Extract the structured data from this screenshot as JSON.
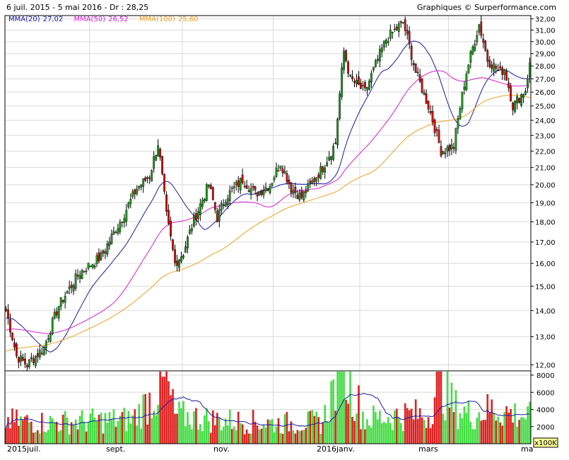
{
  "header": {
    "info": "6 juil. 2015 - 5 mai 2016 - Dr : 28,25",
    "brand": "Graphiques © Surperformance.com"
  },
  "legend": [
    {
      "label": "MMA(20)",
      "value": "27,02",
      "color": "#1a1aa8"
    },
    {
      "label": "MMA(50)",
      "value": "26,52",
      "color": "#d61fd6"
    },
    {
      "label": "MMA(100)",
      "value": "25,60",
      "color": "#f0a020"
    }
  ],
  "colors": {
    "up": "#1f9a1f",
    "down": "#d01010",
    "vol_up": "#44dd44",
    "vol_down": "#dd2020",
    "vol_avg": "#1a1aa8",
    "grid": "#d9d9d9"
  },
  "x_labels": [
    "2015juil.",
    "sept.",
    "nov.",
    "2016janv.",
    "mars",
    "ma"
  ],
  "volume_unit": "x100K",
  "chart_data": [
    {
      "type": "candlestick",
      "y_scale": "log",
      "ylim": [
        11.8,
        32.3
      ],
      "y_ticks": [
        "12,00",
        "13,00",
        "14,00",
        "15,00",
        "16,00",
        "17,00",
        "18,00",
        "19,00",
        "20,00",
        "21,00",
        "22,00",
        "23,00",
        "24,00",
        "25,00",
        "26,00",
        "27,00",
        "28,00",
        "29,00",
        "30,00",
        "31,00",
        "32,00"
      ],
      "grid": true,
      "close_anchors": [
        [
          0,
          14.0
        ],
        [
          5,
          12.3
        ],
        [
          10,
          12.0
        ],
        [
          18,
          12.6
        ],
        [
          25,
          14.2
        ],
        [
          35,
          15.6
        ],
        [
          45,
          16.3
        ],
        [
          55,
          18.2
        ],
        [
          62,
          19.8
        ],
        [
          68,
          20.5
        ],
        [
          72,
          22.5
        ],
        [
          76,
          18.3
        ],
        [
          80,
          16.0
        ],
        [
          84,
          16.5
        ],
        [
          88,
          17.8
        ],
        [
          96,
          20.0
        ],
        [
          100,
          18.2
        ],
        [
          104,
          19.3
        ],
        [
          112,
          20.3
        ],
        [
          118,
          19.5
        ],
        [
          125,
          20.0
        ],
        [
          130,
          21.3
        ],
        [
          135,
          19.8
        ],
        [
          140,
          19.3
        ],
        [
          150,
          21.0
        ],
        [
          156,
          22.5
        ],
        [
          160,
          29.2
        ],
        [
          163,
          27.0
        ],
        [
          170,
          26.0
        ],
        [
          180,
          30.2
        ],
        [
          188,
          31.7
        ],
        [
          194,
          27.5
        ],
        [
          200,
          25.0
        ],
        [
          206,
          22.0
        ],
        [
          212,
          22.3
        ],
        [
          218,
          27.5
        ],
        [
          224,
          31.5
        ],
        [
          228,
          28.5
        ],
        [
          234,
          27.5
        ],
        [
          236,
          27.8
        ],
        [
          240,
          25.0
        ],
        [
          246,
          26.2
        ],
        [
          248,
          28.3
        ]
      ],
      "ma_periods": [
        20,
        50,
        100
      ],
      "ma_last": [
        27.02,
        26.52,
        25.6
      ],
      "last_close": 28.25
    },
    {
      "type": "bar",
      "series": "volume",
      "unit": "x100K",
      "ylim": [
        0,
        8500
      ],
      "y_ticks": [
        "2000",
        "4000",
        "6000",
        "8000"
      ],
      "volume_anchors": [
        [
          0,
          2800
        ],
        [
          20,
          2600
        ],
        [
          40,
          2800
        ],
        [
          60,
          3000
        ],
        [
          70,
          6000
        ],
        [
          76,
          7500
        ],
        [
          80,
          3500
        ],
        [
          100,
          2900
        ],
        [
          130,
          2500
        ],
        [
          150,
          2700
        ],
        [
          159,
          9800
        ],
        [
          170,
          3000
        ],
        [
          190,
          3600
        ],
        [
          200,
          3500
        ],
        [
          205,
          8000
        ],
        [
          212,
          4500
        ],
        [
          220,
          3500
        ],
        [
          230,
          4300
        ],
        [
          240,
          3700
        ],
        [
          248,
          3300
        ]
      ]
    }
  ]
}
